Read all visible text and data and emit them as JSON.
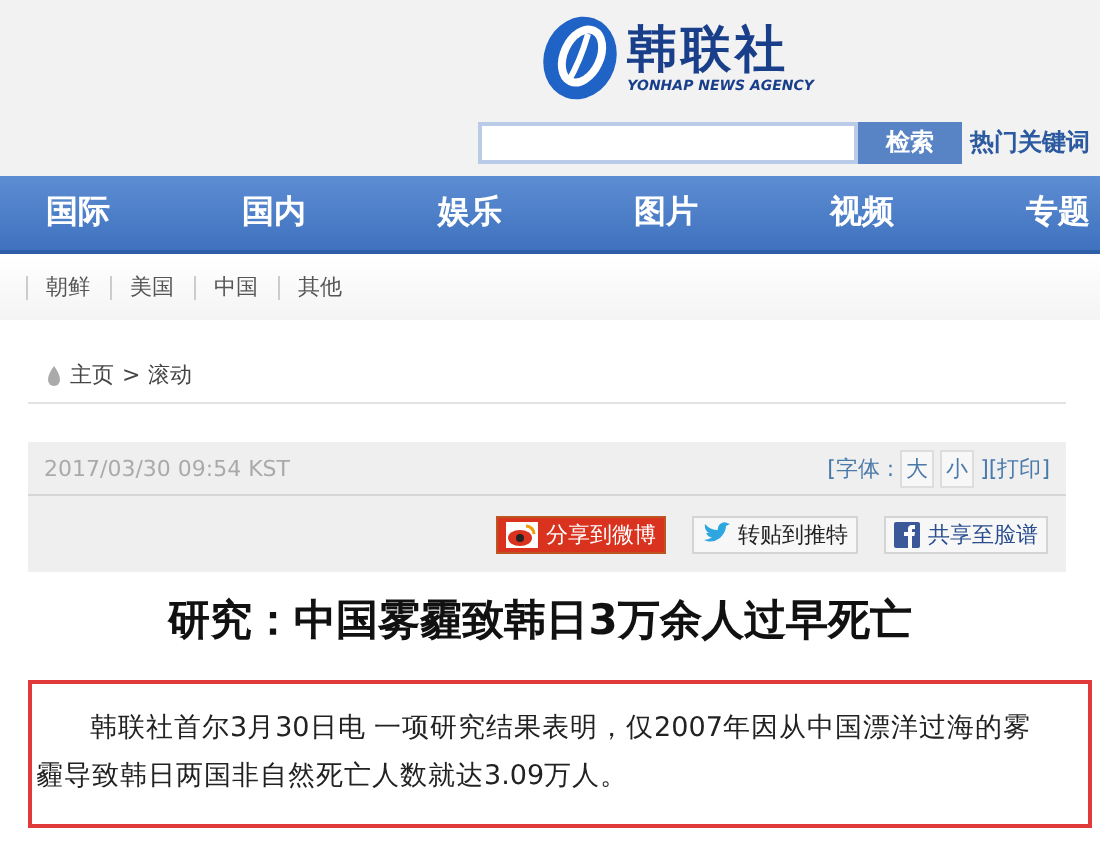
{
  "header": {
    "logo_name": "韩联社",
    "logo_subtitle": "YONHAP NEWS AGENCY",
    "search": {
      "button": "检索",
      "hot_keywords": "热门关键词"
    }
  },
  "nav": [
    "国际",
    "国内",
    "娱乐",
    "图片",
    "视频",
    "专题"
  ],
  "subnav": [
    "朝鲜",
    "美国",
    "中国",
    "其他"
  ],
  "breadcrumb": [
    "主页",
    ">",
    "滚动"
  ],
  "article": {
    "timestamp": "2017/03/30 09:54 KST",
    "font_label": "[字体 :",
    "font_large": "大",
    "font_small": "小",
    "print": "][打印]",
    "share": [
      {
        "kind": "weibo",
        "label": "分享到微博"
      },
      {
        "kind": "twitter",
        "label": "转贴到推特"
      },
      {
        "kind": "facebook",
        "label": "共享至脸谱"
      }
    ],
    "title": "研究：中国雾霾致韩日3万余人过早死亡",
    "lead": "韩联社首尔3月30日电 一项研究结果表明，仅2007年因从中国漂洋过海的雾霾导致韩日两国非自然死亡人数就达3.09万人。"
  }
}
